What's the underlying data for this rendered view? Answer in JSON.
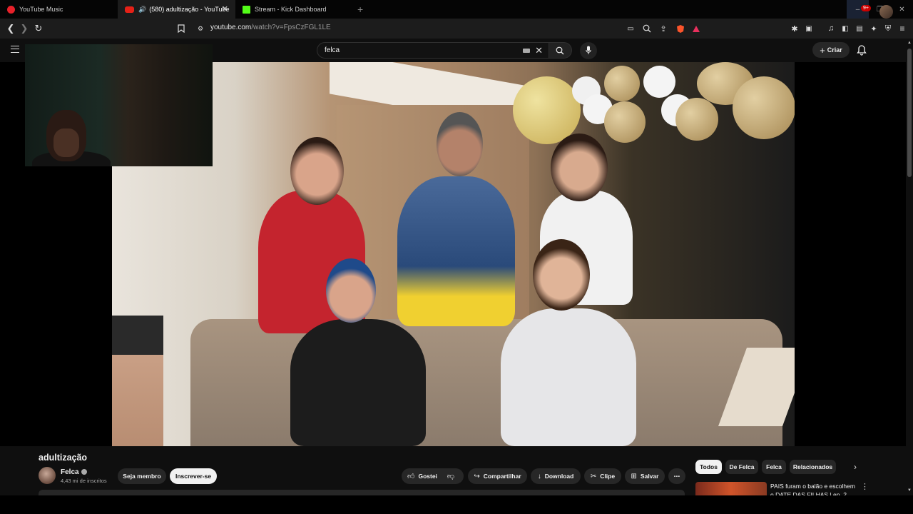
{
  "browser": {
    "tabs": [
      {
        "label": "YouTube Music",
        "icon": "youtube-music-icon",
        "active": false
      },
      {
        "label": "(580) adultização - YouTube",
        "icon": "youtube-icon",
        "active": true,
        "audio": "speaker-icon"
      },
      {
        "label": "Stream - Kick Dashboard",
        "icon": "kick-icon",
        "active": false
      }
    ],
    "new_tab_label": "+",
    "url_host": "youtube.com",
    "url_path": "/watch?v=FpsCzFGL1LE",
    "window_controls": [
      "–",
      "❐",
      "✕"
    ]
  },
  "youtube": {
    "search_value": "felca",
    "create_label": "Criar",
    "notification_count": "9+"
  },
  "video": {
    "title": "adultização",
    "channel_name": "Felca",
    "subscribers": "4,43 mi de inscritos",
    "member_label": "Seja membro",
    "subscribe_label": "Inscrever-se",
    "like_label": "Gostei",
    "share_label": "Compartilhar",
    "download_label": "Download",
    "clip_label": "Clipe",
    "save_label": "Salvar",
    "more_label": "⋯"
  },
  "sidebar": {
    "chips": [
      "Todos",
      "De Felca",
      "Felca",
      "Relacionados"
    ],
    "active_chip": "Todos",
    "recommended_title": "PAIS furam o balão e escolhem o DATE DAS FILHAS | ep. 2"
  },
  "colors": {
    "youtube_red": "#e62117",
    "kick_green": "#53fc18",
    "badge_red": "#cc0000",
    "background": "#0f0f0f"
  }
}
